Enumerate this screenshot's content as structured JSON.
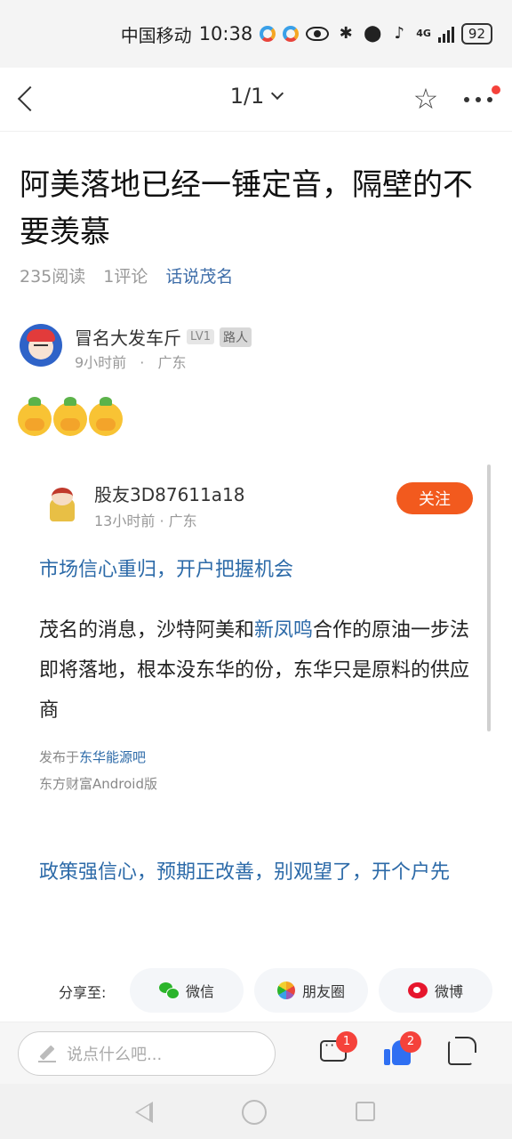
{
  "status_bar": {
    "carrier": "中国移动",
    "time": "10:38",
    "network": "4G",
    "battery": "92",
    "icons": [
      "app-icon",
      "app-icon",
      "eye-icon",
      "bluetooth-icon",
      "location-icon",
      "mic-icon",
      "signal-icon",
      "battery-icon"
    ]
  },
  "nav": {
    "page_indicator": "1/1",
    "icons": [
      "back-icon",
      "chevron-down-icon",
      "star-icon",
      "more-icon"
    ]
  },
  "article": {
    "title": "阿美落地已经一锤定音，隔壁的不要羡慕",
    "reads": "235阅读",
    "comments": "1评论",
    "topic": "话说茂名",
    "author": {
      "name": "冒名大发车斤",
      "level": "LV1",
      "tag": "路人",
      "time": "9小时前",
      "separator": "·",
      "location": "广东"
    }
  },
  "post": {
    "user": "股友3D87611a18",
    "time": "13小时前 · 广东",
    "follow_label": "关注",
    "headline": "市场信心重归，开户把握机会",
    "body_before": "茂名的消息，沙特阿美和",
    "body_link": "新凤鸣",
    "body_after": "合作的原油一步法即将落地，根本没东华的份，东华只是原料的供应商",
    "from_prefix": "发布于",
    "from_link": "东华能源吧",
    "client": "东方财富Android版",
    "promo": "政策强信心，预期正改善，别观望了，开个户先"
  },
  "share": {
    "label": "分享至:",
    "wechat": "微信",
    "moments": "朋友圈",
    "weibo": "微博"
  },
  "bottom": {
    "comment_placeholder": "说点什么吧...",
    "comment_count": "1",
    "like_count": "2"
  },
  "colors": {
    "accent_orange": "#f25a1e",
    "link_blue": "#2c6aa8",
    "badge_red": "#f5423b",
    "like_blue": "#2f6ff2"
  }
}
